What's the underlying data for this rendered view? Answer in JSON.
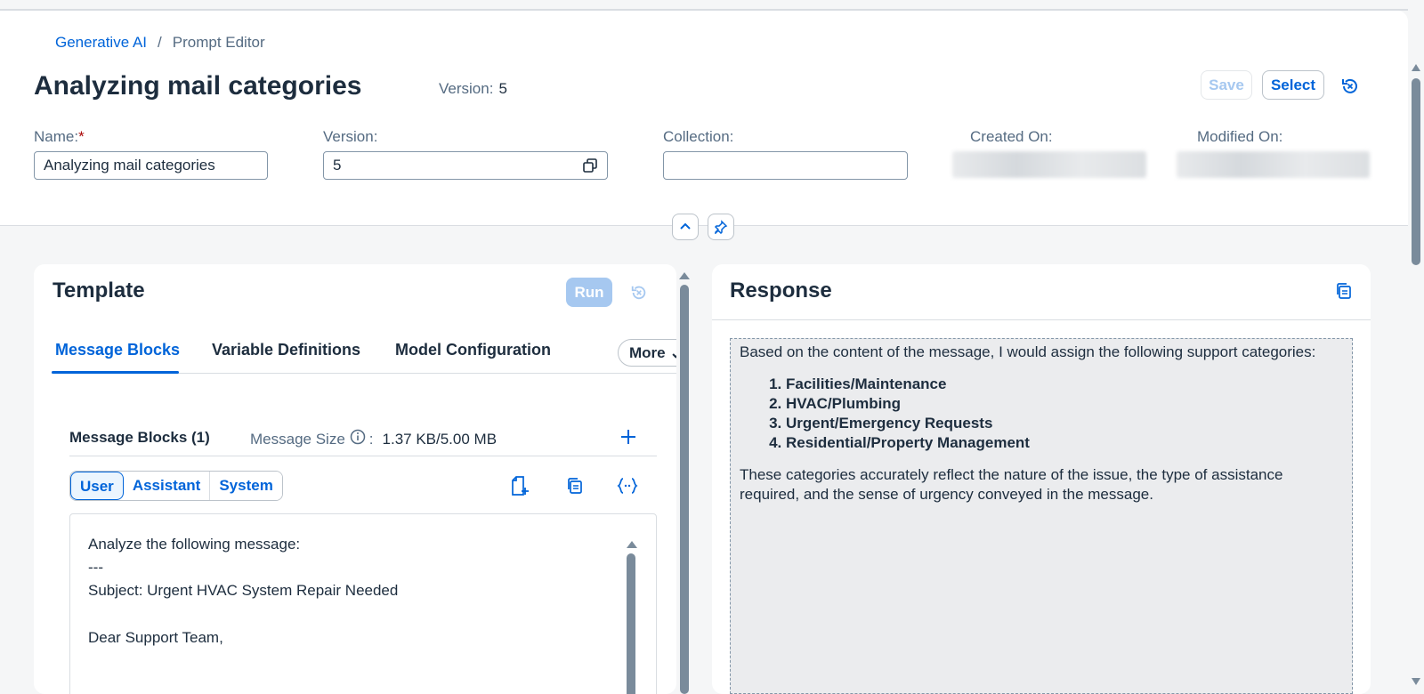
{
  "breadcrumb": {
    "root": "Generative AI",
    "separator": "/",
    "current": "Prompt Editor"
  },
  "header": {
    "title": "Analyzing mail categories",
    "version_label": "Version:",
    "version_value": "5",
    "save_label": "Save",
    "select_label": "Select"
  },
  "fields": {
    "name_label": "Name:",
    "name_required": "*",
    "name_value": "Analyzing mail categories",
    "version_label": "Version:",
    "version_value": "5",
    "collection_label": "Collection:",
    "collection_value": "",
    "created_label": "Created On:",
    "modified_label": "Modified On:"
  },
  "template": {
    "title": "Template",
    "run_label": "Run",
    "tabs": [
      {
        "label": "Message Blocks",
        "active": true
      },
      {
        "label": "Variable Definitions",
        "active": false
      },
      {
        "label": "Model Configuration",
        "active": false
      }
    ],
    "more_label": "More",
    "blocks_title": "Message Blocks (1)",
    "size_label": "Message Size",
    "size_sep": ":",
    "size_value": "1.37 KB/5.00 MB",
    "roles": [
      {
        "label": "User",
        "active": true
      },
      {
        "label": "Assistant",
        "active": false
      },
      {
        "label": "System",
        "active": false
      }
    ],
    "message_lines": [
      "Analyze the following message:",
      "---",
      "Subject: Urgent HVAC System Repair Needed",
      "",
      "Dear Support Team,"
    ]
  },
  "response": {
    "title": "Response",
    "intro": "Based on the content of the message, I would assign the following support categories:",
    "categories": [
      "Facilities/Maintenance",
      "HVAC/Plumbing",
      "Urgent/Emergency Requests",
      "Residential/Property Management"
    ],
    "conclusion": "These categories accurately reflect the nature of the issue, the type of assistance required, and the sense of urgency conveyed in the message."
  },
  "colors": {
    "accent": "#0064d9",
    "text": "#1d2d3e",
    "muted": "#556b82",
    "run_disabled": "#a6c8f0"
  }
}
